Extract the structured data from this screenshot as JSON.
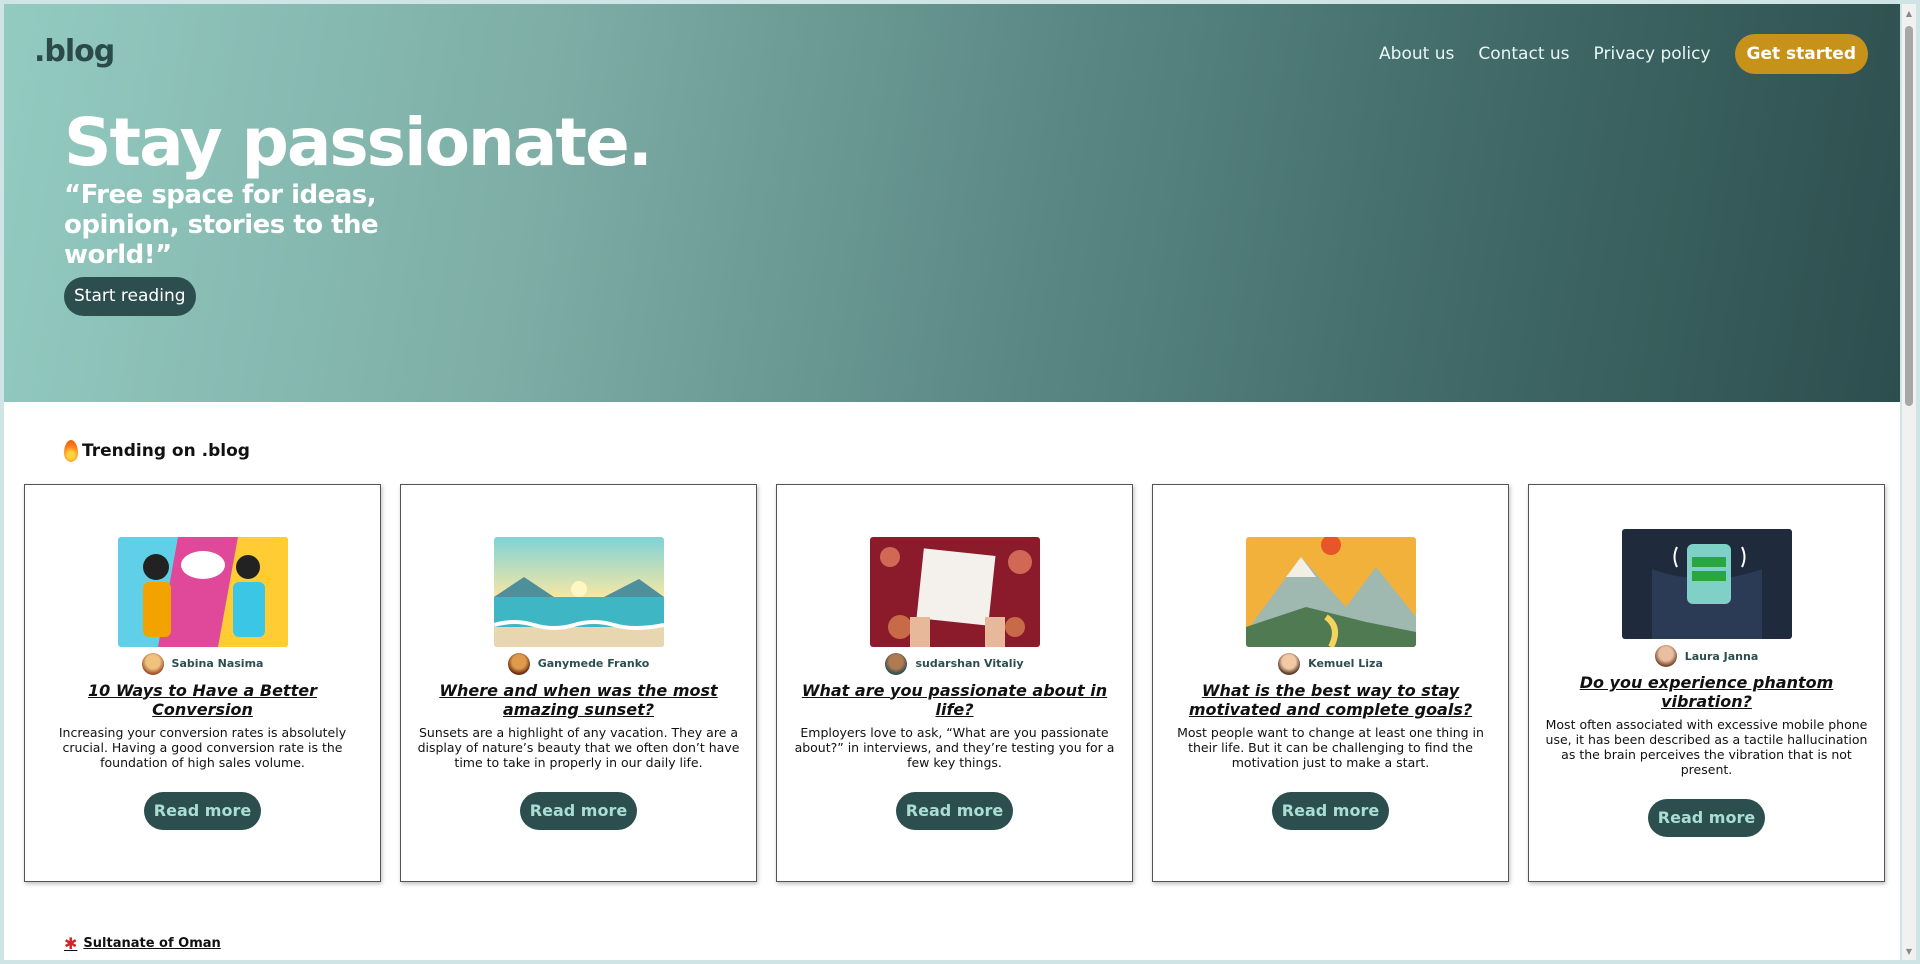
{
  "header": {
    "logo": ".blog",
    "nav": [
      "About us",
      "Contact us",
      "Privacy policy"
    ],
    "cta": "Get started"
  },
  "hero": {
    "title": "Stay passionate.",
    "subtitle": "“Free space for ideas, opinion, stories to the world!”",
    "button": "Start reading"
  },
  "trending": {
    "heading": "Trending on .blog",
    "icon": "flame-icon",
    "cards": [
      {
        "image": "conversation-illustration",
        "author": "Sabina Nasima",
        "title": "10 Ways to Have a Better Conversion",
        "description": "Increasing your conversion rates is absolutely crucial. Having a good conversion rate is the foundation of high sales volume.",
        "button": "Read more"
      },
      {
        "image": "sunset-beach-illustration",
        "author": "Ganymede Franko",
        "title": "Where and when was the most amazing sunset?",
        "description": "Sunsets are a highlight of any vacation. They are a display of nature’s beauty that we often don’t have time to take in properly in our daily life.",
        "button": "Read more"
      },
      {
        "image": "find-your-passion-sign",
        "author": "sudarshan Vitaliy",
        "title": "What are you passionate about in life?",
        "description": "Employers love to ask, “What are you passionate about?” in interviews, and they’re testing you for a few key things.",
        "button": "Read more"
      },
      {
        "image": "stay-motivated-mountain",
        "author": "Kemuel Liza",
        "title": "What is the best way to stay motivated and complete goals?",
        "description": "Most people want to change at least one thing in their life. But it can be challenging to find the motivation just to make a start.",
        "button": "Read more"
      },
      {
        "image": "phone-pocket-vibration",
        "author": "Laura Janna",
        "title": "Do you experience phantom vibration?",
        "description": "Most often associated with excessive mobile phone use, it has been described as a tactile hallucination as the brain perceives the vibration that is not present.",
        "button": "Read more"
      }
    ]
  },
  "footer_link": "Sultanate of Oman",
  "colors": {
    "primary_dark": "#2d4e4e",
    "accent": "#c7921a",
    "hero_light": "#93cbc1"
  }
}
